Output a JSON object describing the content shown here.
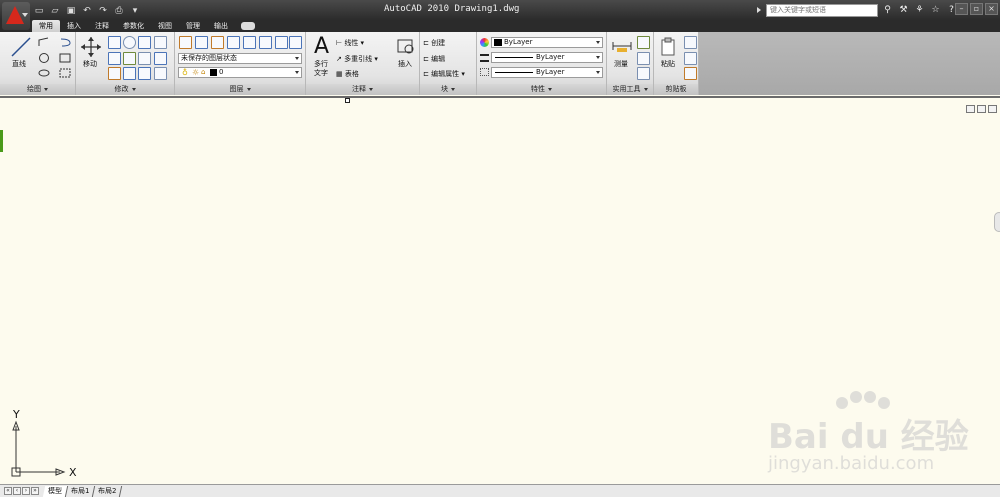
{
  "window": {
    "title": "AutoCAD 2010  Drawing1.dwg",
    "search_placeholder": "键入关键字或短语"
  },
  "tabs": [
    {
      "label": "常用",
      "active": true
    },
    {
      "label": "插入"
    },
    {
      "label": "注释"
    },
    {
      "label": "参数化"
    },
    {
      "label": "视图"
    },
    {
      "label": "管理"
    },
    {
      "label": "输出"
    }
  ],
  "panels": {
    "draw": {
      "title": "绘图",
      "line_label": "直线"
    },
    "modify": {
      "title": "修改",
      "move_label": "移动"
    },
    "layers": {
      "title": "图层",
      "layer_state": "未保存的图层状态",
      "current_layer": "0"
    },
    "annotation": {
      "title": "注释",
      "mtext_label_1": "多行",
      "mtext_label_2": "文字",
      "linear_label": "线性",
      "mleader_label": "多重引线",
      "table_label": "表格",
      "big_glyph": "A"
    },
    "block": {
      "title": "块",
      "insert_label": "插入",
      "create_label": "创建",
      "edit_label": "编辑",
      "edit_attr_label": "编辑属性"
    },
    "properties": {
      "title": "特性",
      "color_value": "ByLayer",
      "linetype_value": "ByLayer",
      "lineweight_value": "ByLayer"
    },
    "utilities": {
      "title": "实用工具",
      "measure_label": "测量"
    },
    "clipboard": {
      "title": "剪贴板",
      "paste_label": "粘贴"
    }
  },
  "ucs": {
    "x_label": "X",
    "y_label": "Y"
  },
  "layout_tabs": [
    {
      "label": "模型",
      "active": true
    },
    {
      "label": "布局1"
    },
    {
      "label": "布局2"
    }
  ],
  "watermark": {
    "main": "Bai du 经验",
    "sub": "jingyan.baidu.com"
  },
  "colors": {
    "accent": "#d6281c",
    "canvas": "#fdfbee",
    "titlebar": "#2b2b2b"
  }
}
